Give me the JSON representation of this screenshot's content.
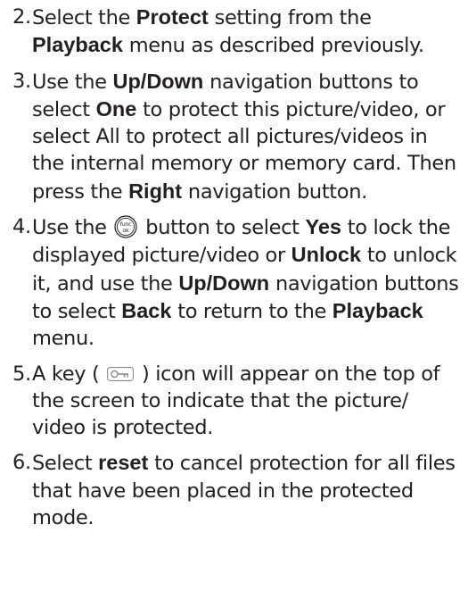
{
  "steps": [
    {
      "number": "2.",
      "t1": "Select the ",
      "b1": "Protect",
      "t2": " setting from the ",
      "b2": "Playback",
      "t3": " menu as described previously."
    },
    {
      "number": "3.",
      "t1": "Use the ",
      "b1": "Up/Down",
      "t2": " navigation buttons to select ",
      "b2": "One",
      "t3": " to protect this picture/video, or select All to protect all pictures/videos in the internal memory or memory card.  Then press the ",
      "b3": "Right",
      "t4": " navigation button."
    },
    {
      "number": "4.",
      "t1": "Use the ",
      "icon_label_top": "func",
      "icon_label_bottom": "ok",
      "t2": " button to select ",
      "b1": "Yes",
      "t3": " to lock the displayed picture/video or ",
      "b2": "Unlock",
      "t4": " to unlock it, and use the ",
      "b3": "Up/Down",
      "t5": " navigation buttons to select ",
      "b4": "Back",
      "t6": " to return to the ",
      "b5": "Playback",
      "t7": " menu."
    },
    {
      "number": "5.",
      "t1": "A key ( ",
      "t2": " ) icon will appear on the top of the screen to indicate that the picture/ video is protected."
    },
    {
      "number": "6.",
      "t1": " Select ",
      "b1": "reset",
      "t2": " to cancel protection for all files that have been placed in the protected mode."
    }
  ],
  "icons": {
    "func_ok_button": "func-ok-button-icon",
    "protect_key": "key-icon"
  }
}
